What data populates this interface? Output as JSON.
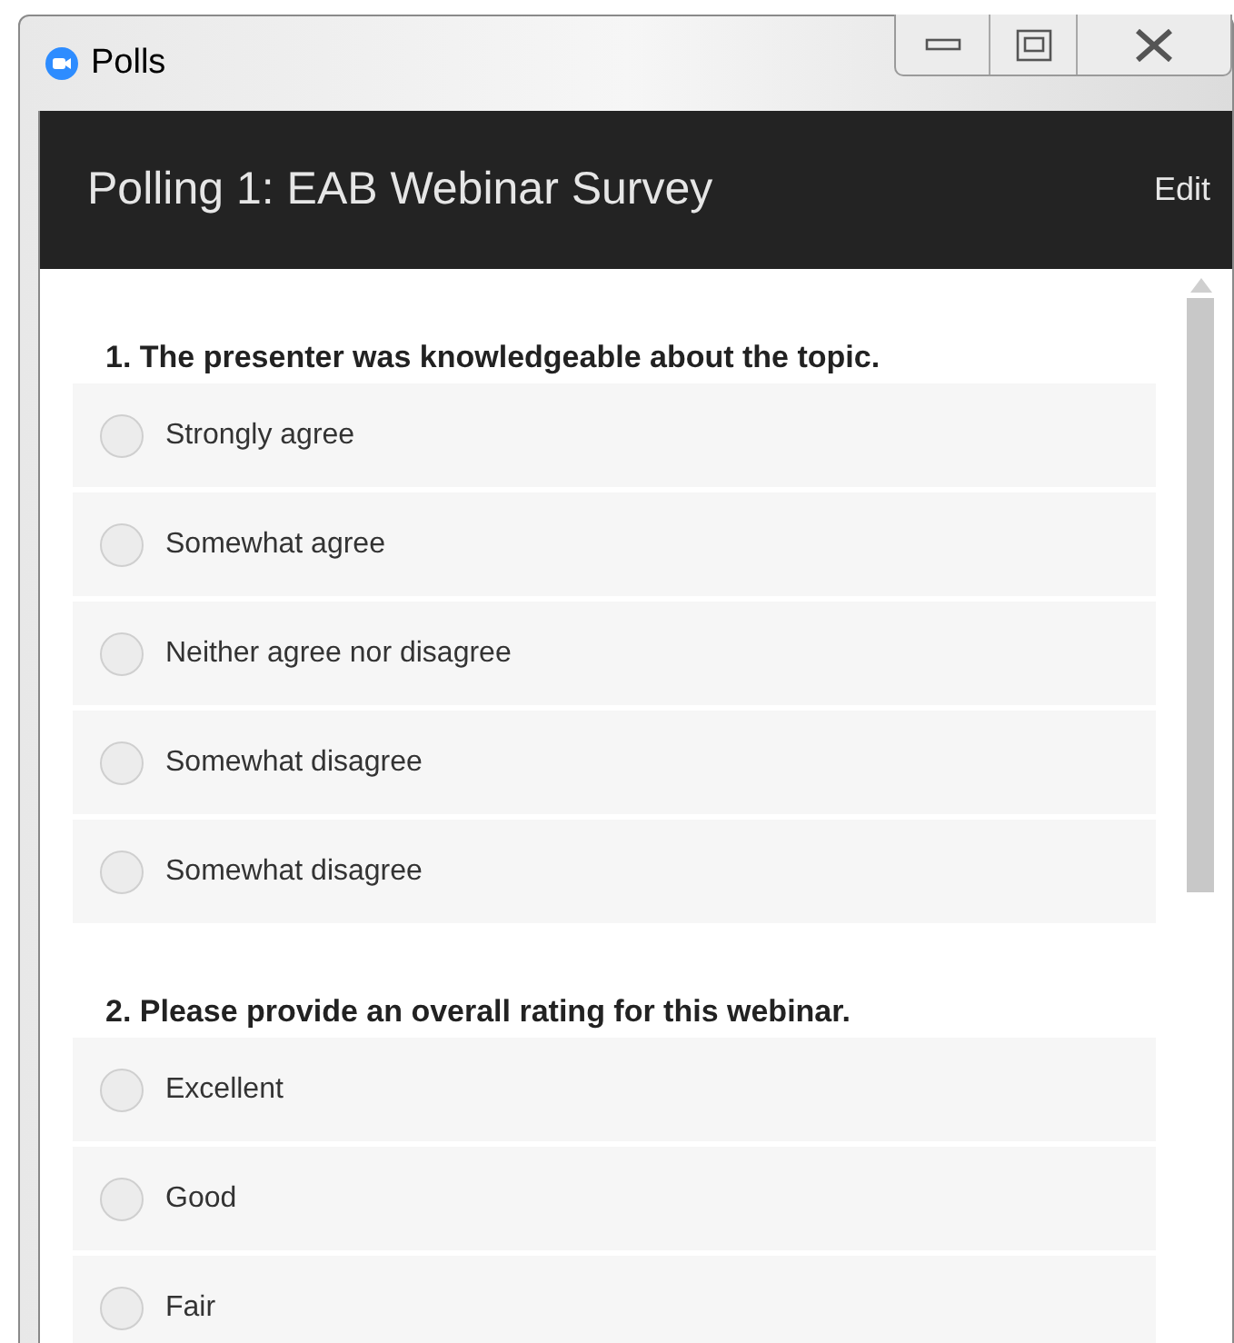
{
  "window": {
    "title": "Polls"
  },
  "header": {
    "title": "Polling 1: EAB Webinar Survey",
    "action": "Edit"
  },
  "questions": [
    {
      "text": "1. The presenter was knowledgeable about the topic.",
      "options": [
        {
          "label": "Strongly agree",
          "selected": false
        },
        {
          "label": "Somewhat agree",
          "selected": false
        },
        {
          "label": "Neither agree nor disagree",
          "selected": false
        },
        {
          "label": "Somewhat disagree",
          "selected": false
        },
        {
          "label": "Somewhat disagree",
          "selected": false
        }
      ]
    },
    {
      "text": "2. Please provide an overall rating for this webinar.",
      "options": [
        {
          "label": "Excellent",
          "selected": false
        },
        {
          "label": "Good",
          "selected": false
        },
        {
          "label": "Fair",
          "selected": false
        }
      ]
    }
  ]
}
